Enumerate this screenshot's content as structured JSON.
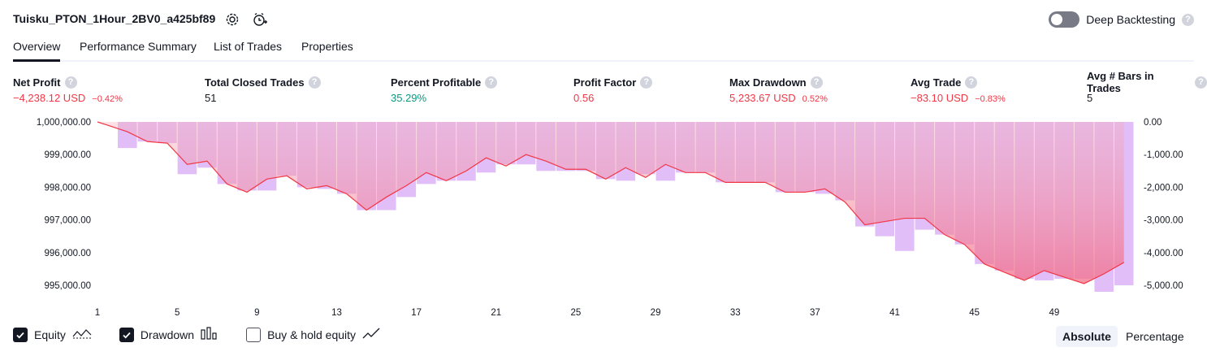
{
  "header": {
    "strategy_name": "Tuisku_PTON_1Hour_2BV0_a425bf89",
    "deep_backtesting_label": "Deep Backtesting",
    "help_glyph": "?"
  },
  "tabs": [
    {
      "label": "Overview"
    },
    {
      "label": "Performance Summary"
    },
    {
      "label": "List of Trades"
    },
    {
      "label": "Properties"
    }
  ],
  "metrics": [
    {
      "label": "Net Profit",
      "value": "−4,238.12 USD",
      "pct": "−0.42%",
      "tone": "neg"
    },
    {
      "label": "Total Closed Trades",
      "value": "51",
      "pct": "",
      "tone": "neutral"
    },
    {
      "label": "Percent Profitable",
      "value": "35.29%",
      "pct": "",
      "tone": "pos"
    },
    {
      "label": "Profit Factor",
      "value": "0.56",
      "pct": "",
      "tone": "neg"
    },
    {
      "label": "Max Drawdown",
      "value": "5,233.67 USD",
      "pct": "0.52%",
      "tone": "neg"
    },
    {
      "label": "Avg Trade",
      "value": "−83.10 USD",
      "pct": "−0.83%",
      "tone": "neg"
    },
    {
      "label": "Avg # Bars in Trades",
      "value": "5",
      "pct": "",
      "tone": "neutral"
    }
  ],
  "legend": {
    "equity": "Equity",
    "drawdown": "Drawdown",
    "buy_hold": "Buy & hold equity"
  },
  "modes": {
    "absolute": "Absolute",
    "percentage": "Percentage"
  },
  "colors": {
    "equity_line": "#f23645",
    "drawdown_bar": "#e1bef7",
    "negative": "#f23645",
    "positive": "#089981"
  },
  "chart_data": {
    "type": "area",
    "x_ticks": [
      "1",
      "5",
      "9",
      "13",
      "17",
      "21",
      "25",
      "29",
      "33",
      "37",
      "41",
      "45",
      "49"
    ],
    "left_axis": {
      "ticks": [
        "1,000,000.00",
        "999,000.00",
        "998,000.00",
        "997,000.00",
        "996,000.00",
        "995,000.00"
      ],
      "range": [
        994800,
        1000000
      ]
    },
    "right_axis": {
      "ticks": [
        "0.00",
        "-1,000.00",
        "-2,000.00",
        "-3,000.00",
        "-4,000.00",
        "-5,000.00"
      ],
      "range": [
        -5200,
        0
      ]
    },
    "series": [
      {
        "name": "Equity",
        "x": [
          1,
          2,
          3,
          4,
          5,
          6,
          7,
          8,
          9,
          10,
          11,
          12,
          13,
          14,
          15,
          16,
          17,
          18,
          19,
          20,
          21,
          22,
          23,
          24,
          25,
          26,
          27,
          28,
          29,
          30,
          31,
          32,
          33,
          34,
          35,
          36,
          37,
          38,
          39,
          40,
          41,
          42,
          43,
          44,
          45,
          46,
          47,
          48,
          49,
          50,
          51,
          52
        ],
        "values": [
          1000000,
          999700,
          999400,
          999350,
          998700,
          998800,
          998100,
          997850,
          998250,
          998350,
          997950,
          998050,
          997800,
          997300,
          997700,
          998050,
          998450,
          998200,
          998500,
          998900,
          998650,
          999000,
          998800,
          998550,
          998550,
          998250,
          998600,
          998300,
          998700,
          998450,
          998450,
          998150,
          998150,
          998150,
          997850,
          997850,
          997950,
          997550,
          996850,
          996950,
          997050,
          997050,
          996550,
          996250,
          995650,
          995400,
          995150,
          995450,
          995250,
          995050,
          995350,
          995700
        ]
      },
      {
        "name": "Drawdown",
        "x": [
          1,
          2,
          3,
          4,
          5,
          6,
          7,
          8,
          9,
          10,
          11,
          12,
          13,
          14,
          15,
          16,
          17,
          18,
          19,
          20,
          21,
          22,
          23,
          24,
          25,
          26,
          27,
          28,
          29,
          30,
          31,
          32,
          33,
          34,
          35,
          36,
          37,
          38,
          39,
          40,
          41,
          42,
          43,
          44,
          45,
          46,
          47,
          48,
          49,
          50,
          51,
          52
        ],
        "values": [
          0,
          -800,
          -600,
          -650,
          -1600,
          -1400,
          -1900,
          -2100,
          -2100,
          -1650,
          -2000,
          -2050,
          -2200,
          -2700,
          -2700,
          -2300,
          -1900,
          -1800,
          -1800,
          -1550,
          -1300,
          -1300,
          -1500,
          -1500,
          -1500,
          -1750,
          -1800,
          -1600,
          -1800,
          -1550,
          -1550,
          -1850,
          -1850,
          -1850,
          -2150,
          -2150,
          -2200,
          -2400,
          -3200,
          -3500,
          -3950,
          -3300,
          -3450,
          -3750,
          -4350,
          -4550,
          -4800,
          -4850,
          -4800,
          -4800,
          -5200,
          -5000
        ]
      }
    ]
  }
}
